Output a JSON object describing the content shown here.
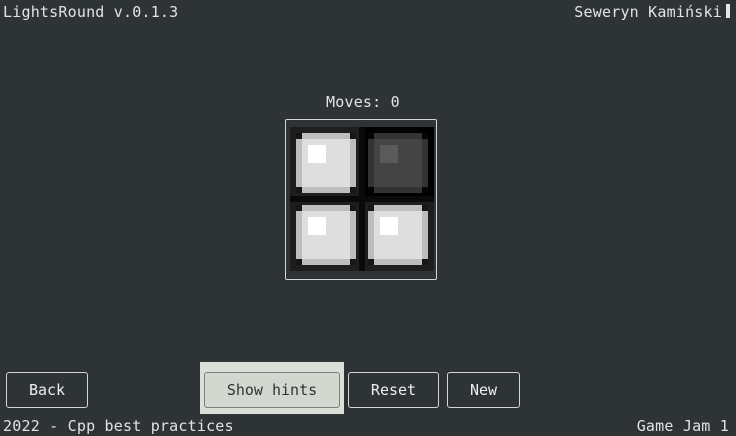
{
  "header": {
    "title": "LightsRound v.0.1.3",
    "author": "Seweryn Kamiński"
  },
  "status": {
    "moves_label": "Moves: 0"
  },
  "board": {
    "rows": 2,
    "cols": 2,
    "cells": [
      {
        "row": 0,
        "col": 0,
        "state": "on"
      },
      {
        "row": 0,
        "col": 1,
        "state": "off"
      },
      {
        "row": 1,
        "col": 0,
        "state": "on"
      },
      {
        "row": 1,
        "col": 1,
        "state": "on"
      }
    ]
  },
  "buttons": {
    "back": "Back",
    "show_hints": "Show hints",
    "reset": "Reset",
    "new": "New"
  },
  "footer": {
    "left": "2022 - Cpp best practices",
    "right": "Game Jam 1"
  },
  "colors": {
    "background": "#2e3436",
    "text": "#e3e3e3",
    "button_border": "#d3d7cf",
    "highlight_button": "#d3d7cf",
    "light_on": "#e6e6e6",
    "light_off": "#4a4a4a"
  }
}
